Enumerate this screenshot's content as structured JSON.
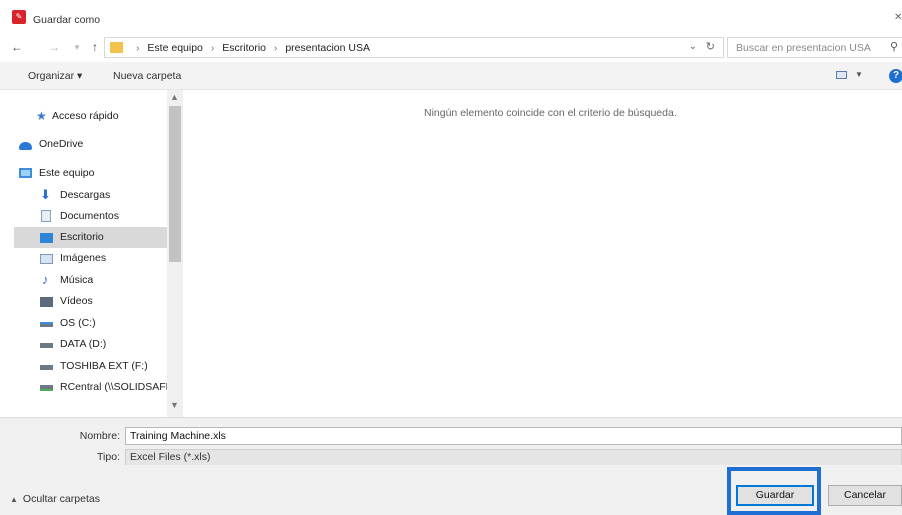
{
  "window": {
    "title": "Guardar como",
    "app_icon": "pdf-app-icon"
  },
  "nav_buttons": [
    {
      "name": "back-icon",
      "glyph": "←"
    },
    {
      "name": "forward-icon",
      "glyph": "→"
    },
    {
      "name": "recent-dropdown-icon",
      "glyph": "▾"
    },
    {
      "name": "up-icon",
      "glyph": "↑"
    }
  ],
  "address": {
    "crumbs": [
      "Este equipo",
      "Escritorio",
      "presentacion USA"
    ],
    "separator": "›"
  },
  "search": {
    "placeholder": "Buscar en presentacion USA"
  },
  "toolbar": {
    "organize": "Organizar ▾",
    "new_folder": "Nueva carpeta",
    "help": "?"
  },
  "sidebar": {
    "items": [
      {
        "label": "Acceso rápido",
        "icon": "star-icon"
      },
      {
        "label": "OneDrive",
        "icon": "cloud-icon"
      },
      {
        "label": "Este equipo",
        "icon": "computer-icon"
      },
      {
        "label": "Descargas",
        "icon": "download-icon"
      },
      {
        "label": "Documentos",
        "icon": "document-icon"
      },
      {
        "label": "Escritorio",
        "icon": "desktop-icon",
        "selected": true
      },
      {
        "label": "Imágenes",
        "icon": "pictures-icon"
      },
      {
        "label": "Música",
        "icon": "music-icon"
      },
      {
        "label": "Vídeos",
        "icon": "video-icon"
      },
      {
        "label": "OS (C:)",
        "icon": "drive-icon"
      },
      {
        "label": "DATA (D:)",
        "icon": "drive-icon"
      },
      {
        "label": "TOSHIBA EXT (F:)",
        "icon": "drive-icon"
      },
      {
        "label": "RCentral (\\\\SOLIDSAFE",
        "icon": "network-drive-icon"
      }
    ]
  },
  "content": {
    "empty_message": "Ningún elemento coincide con el criterio de búsqueda."
  },
  "form": {
    "name_label": "Nombre:",
    "name_value": "Training Machine.xls",
    "type_label": "Tipo:",
    "type_value": "Excel Files (*.xls)"
  },
  "footer": {
    "hide_folders": "Ocultar carpetas",
    "save": "Guardar",
    "cancel": "Cancelar"
  },
  "colors": {
    "accent": "#0078d7",
    "highlight_box": "#1f6ed4",
    "selected_bg": "#d9d9d9"
  }
}
